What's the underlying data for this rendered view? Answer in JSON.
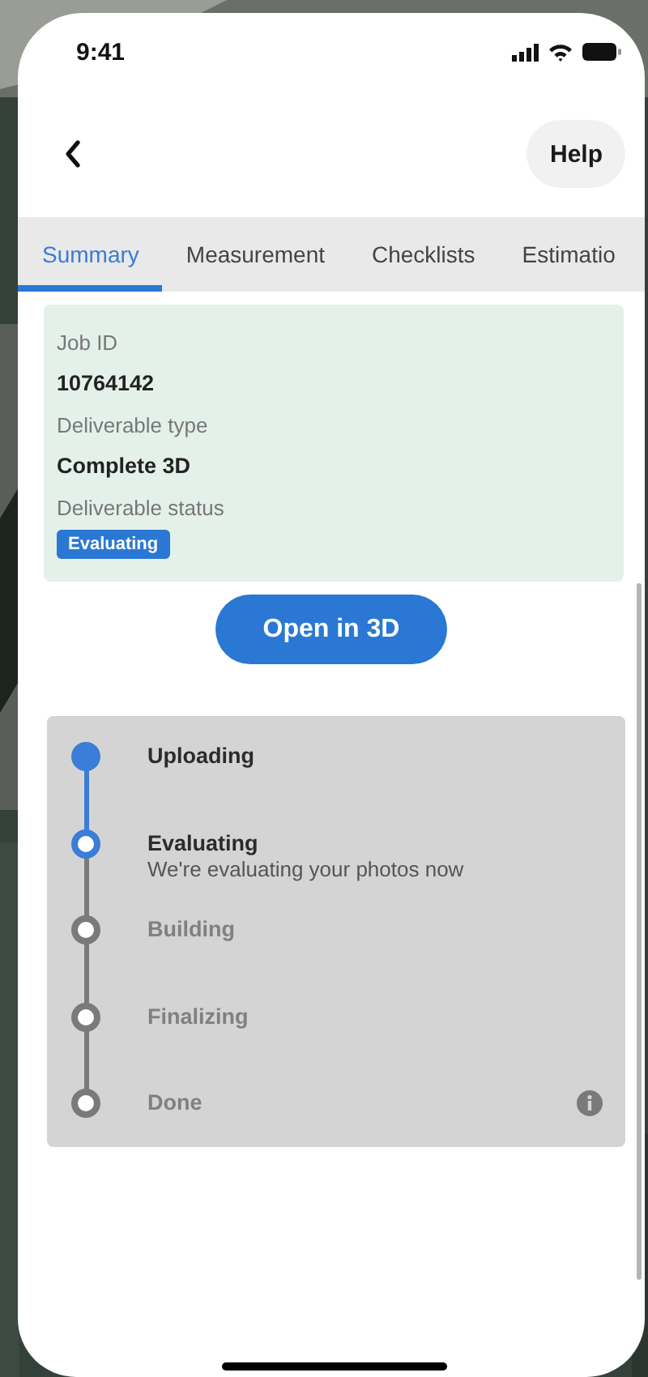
{
  "status_bar": {
    "time": "9:41"
  },
  "header": {
    "help_button": "Help"
  },
  "tabs": [
    {
      "label": "Summary",
      "selected": true
    },
    {
      "label": "Measurement",
      "selected": false
    },
    {
      "label": "Checklists",
      "selected": false
    },
    {
      "label": "Estimatio",
      "selected": false
    }
  ],
  "job_card": {
    "fields": [
      {
        "label": "Job ID",
        "value": "10764142"
      },
      {
        "label": "Deliverable type",
        "value": "Complete 3D"
      }
    ],
    "status_label": "Deliverable status",
    "status_badge": "Evaluating"
  },
  "open_button": "Open in 3D",
  "steps": [
    {
      "title": "Uploading",
      "done": true,
      "current": false
    },
    {
      "title": "Evaluating",
      "done": false,
      "current": true,
      "description": "We're evaluating your photos now"
    },
    {
      "title": "Building",
      "done": false,
      "current": false
    },
    {
      "title": "Finalizing",
      "done": false,
      "current": false
    },
    {
      "title": "Done",
      "done": false,
      "current": false,
      "info": true
    }
  ]
}
